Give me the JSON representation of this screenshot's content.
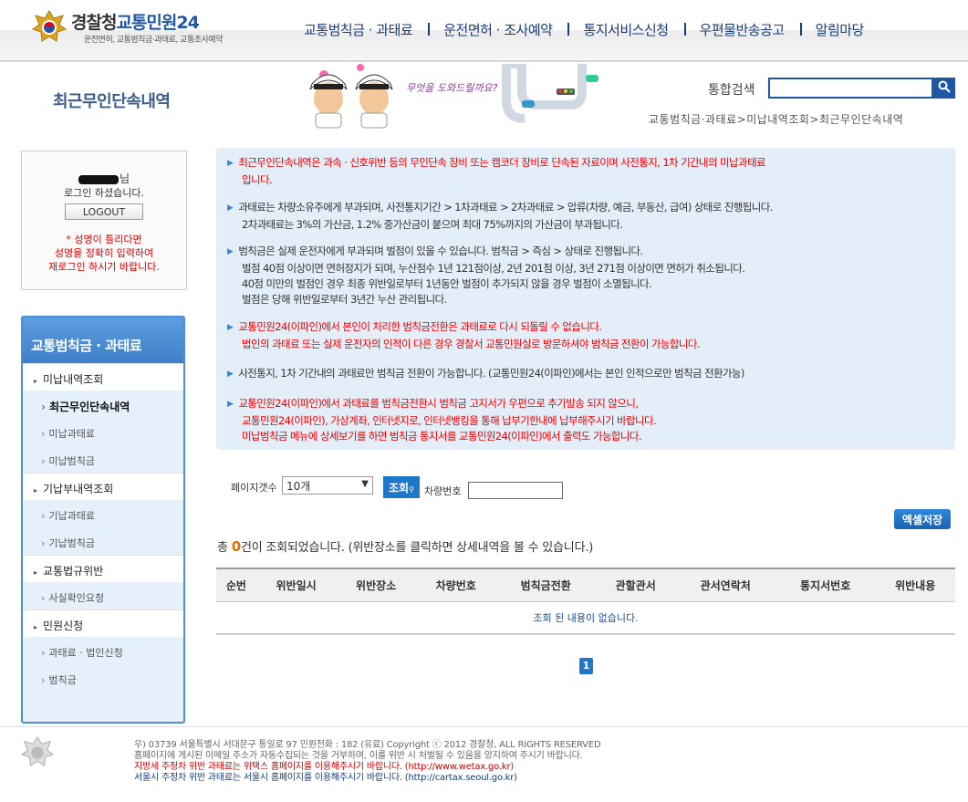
{
  "header": {
    "logo_main": "경찰청",
    "logo_accent": "교통민원24",
    "logo_sub": "운전면허, 교통범칙금·과태료, 교통조사예약",
    "nav": [
      "교통범칙금 · 과태료",
      "운전면허 · 조사예약",
      "통지서비스신청",
      "우편물반송공고",
      "알림마당"
    ]
  },
  "visual": {
    "page_title": "최근무인단속내역",
    "mascot_text": "무엇을 도와드릴까요?",
    "search_label": "통합검색",
    "breadcrumb": "교통범칙금·과태료>미납내역조회>최근무인단속내역"
  },
  "login": {
    "name_suffix": "님",
    "message": "로그인 하셨습니다.",
    "logout_label": "LOGOUT",
    "warn1": "* 성명이 틀리다면",
    "warn2": "성명을 정확히 입력하여",
    "warn3": "재로그인 하시기 바랍니다."
  },
  "sidebar": {
    "title": "교통범칙금 · 과태료",
    "items": [
      {
        "label": "미납내역조회"
      },
      {
        "label": "최근무인단속내역"
      },
      {
        "label": "미납과태료"
      },
      {
        "label": "미납범칙금"
      },
      {
        "label": "기납부내역조회"
      },
      {
        "label": "기납과태료"
      },
      {
        "label": "기납범칙금"
      },
      {
        "label": "교통법규위반"
      },
      {
        "label": "사실확인요청"
      },
      {
        "label": "민원신청"
      },
      {
        "label": "과태료 · 법인신청"
      },
      {
        "label": "범칙금"
      }
    ]
  },
  "info": {
    "p1a": "최근무인단속내역은 과속 · 신호위반 등의 무인단속 장비 또는 캠코더 장비로 단속된 자료이며 사전통지, 1차 기간내의 미납과태료",
    "p1b": "입니다.",
    "p2a": "과태료는 차량소유주에게 부과되며, 사전통지기간 > 1차과태료 > 2차과태료 > 압류(차량, 예금, 부동산, 급여) 상태로 진행됩니다.",
    "p2b": "2차과태료는 3%의 가산금, 1.2% 중가산금이 붙으며 최대 75%까지의 가산금이 부과됩니다.",
    "p3a": "범칙금은 실제 운전자에게 부과되며 벌점이 있을 수 있습니다. 범칙금 > 즉심 > 상태로 진행됩니다.",
    "p3b": "벌점 40점 이상이면 면허정지가 되며, 누산점수 1년 121점이상, 2년 201점 이상, 3년 271점 이상이면 면허가 취소됩니다.",
    "p3c": "40점 미만의 벌점인 경우 최종 위반일로부터 1년동안 벌점이 추가되지 않을 경우 벌점이 소멸됩니다.",
    "p3d": "벌점은 당해 위반일로부터 3년간 누산 관리됩니다.",
    "p4a": "교통민원24(이파인)에서 본인이 처리한 범칙금전환은 과태료로 다시 되돌릴 수 없습니다.",
    "p4b": "법인의 과태료 또는 실제 운전자의 인적이 다른 경우 경찰서 교통민원실로 방문하셔야 범칙금 전환이 가능합니다.",
    "p5": "사전통지, 1차 기간내의 과태료만 범칙금 전환이 가능합니다. (교통민원24(이파인)에서는 본인 인적으로만 범칙금 전환가능)",
    "p6a": "교통민원24(이파인)에서 과태료를 범칙금전환시 범칙금 고지서가 우편으로 추가발송 되지 않으니,",
    "p6b": "교통민원24(이파인), 가상계좌, 인터넷지로, 인터넷뱅킹을 통해 납부기한내에 납부해주시기 바랍니다.",
    "p6c": "미납범칙금 메뉴에 상세보기를 하면 범칙금 통지서를 교통민원24(이파인)에서 출력도 가능합니다."
  },
  "filter": {
    "page_label": "페이지갯수",
    "page_selected": "10개",
    "query_label": "조회",
    "car_label": "차량번호",
    "car_value": ""
  },
  "excel_label": "엑셀저장",
  "result": {
    "prefix": "총 ",
    "count": "0",
    "suffix": "건이 조회되었습니다. (위반장소를 클릭하면 상세내역을 볼 수 있습니다.)"
  },
  "table": {
    "headers": [
      "순번",
      "위반일시",
      "위반장소",
      "차량번호",
      "범칙금전환",
      "관할관서",
      "관서연락처",
      "통지서번호",
      "위반내용"
    ],
    "empty_message": "조회 된 내용이 없습니다."
  },
  "pager": {
    "current": "1"
  },
  "footer": {
    "line1": "우) 03739 서울특별시 서대문구 통일로 97  민원전화 : 182 (유료)        Copyright ⓒ 2012 경찰청, ALL RIGHTS RESERVED",
    "line2": "홈페이지에 게시된 이메일 주소가 자동수집되는 것을 거부하며, 이를 위반 시 처벌될 수 있음을 양지하여 주시기 바랍니다.",
    "line3": "지방세 주정차 위반 과태료는 위택스 홈페이지를 이용해주시기 바랍니다. (http://www.wetax.go.kr)",
    "line4": "서울시 주정차 위반 과태료는 서울시 홈페이지를 이용해주시기 바랍니다. (http://cartax.seoul.go.kr)"
  },
  "colors": {
    "brand_blue": "#1f56a6",
    "accent_blue": "#1f77c9",
    "warning_red": "#e00000",
    "count_orange": "#e07000"
  }
}
